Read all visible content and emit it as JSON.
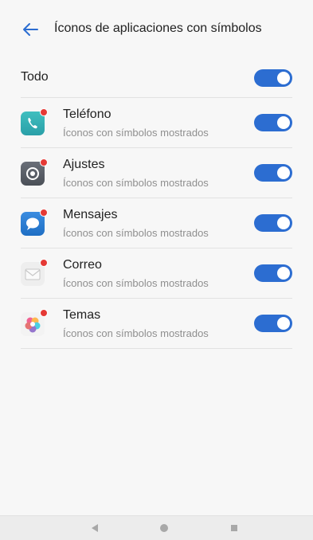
{
  "header": {
    "title": "Íconos de aplicaciones con símbolos",
    "back_icon": "arrow-left-icon"
  },
  "all_row": {
    "label": "Todo",
    "enabled": true
  },
  "apps": [
    {
      "name": "Teléfono",
      "subtitle": "Íconos con símbolos mostrados",
      "icon": "phone-app-icon",
      "enabled": true
    },
    {
      "name": "Ajustes",
      "subtitle": "Íconos con símbolos mostrados",
      "icon": "settings-app-icon",
      "enabled": true
    },
    {
      "name": "Mensajes",
      "subtitle": "Íconos con símbolos mostrados",
      "icon": "messages-app-icon",
      "enabled": true
    },
    {
      "name": "Correo",
      "subtitle": "Íconos con símbolos mostrados",
      "icon": "mail-app-icon",
      "enabled": true
    },
    {
      "name": "Temas",
      "subtitle": "Íconos con símbolos mostrados",
      "icon": "themes-app-icon",
      "enabled": true
    }
  ],
  "colors": {
    "accent": "#2c6dd1",
    "badge": "#e53935"
  },
  "navbar": {
    "back_icon": "nav-back-icon",
    "home_icon": "nav-home-icon",
    "recent_icon": "nav-recent-icon"
  }
}
